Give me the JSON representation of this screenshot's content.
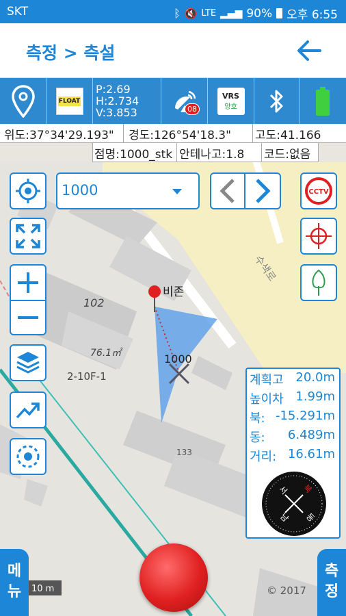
{
  "status_bar": {
    "carrier": "SKT",
    "network": "LTE",
    "battery": "90%",
    "time": "오후 6:55"
  },
  "header": {
    "title": "측정 > 측설"
  },
  "info_bar": {
    "fix_badge": "FLOAT",
    "p": "P:2.69",
    "h": "H:2.734",
    "v": "V:3.853",
    "satellite_count": "08",
    "vrs_label": "VRS",
    "vrs_status": "양호"
  },
  "coords": {
    "lat": "위도:37°34'29.193\"",
    "lon": "경도:126°54'18.3\"",
    "alt": "고도:41.166"
  },
  "point_info": {
    "point_name": "점명:1000_stk",
    "antenna_height": "안테나고:1.8",
    "code": "코드:없음"
  },
  "point_select": {
    "value": "1000"
  },
  "map": {
    "labels": {
      "building_102": "102",
      "area_76": "76.1㎡",
      "lot_2_10": "2-10F-1",
      "target": "1000",
      "vision": "비존",
      "number_133": "133",
      "road_name": "수색로",
      "scale": "10 m",
      "copyright": "© 2017"
    }
  },
  "stakeout_panel": {
    "plan_height_label": "계획고",
    "plan_height_value": "20.0m",
    "height_diff_label": "높이차",
    "height_diff_value": "1.99m",
    "north_label": "북:",
    "north_value": "-15.291m",
    "east_label": "동:",
    "east_value": "6.489m",
    "distance_label": "거리:",
    "distance_value": "16.61m"
  },
  "compass": {
    "north": "북",
    "south": "남",
    "east": "동",
    "west": "서"
  },
  "bottom": {
    "menu_label": "메뉴",
    "measure_label": "측정"
  },
  "colors": {
    "accent": "#1e86d6",
    "record_button": "#e02020"
  }
}
